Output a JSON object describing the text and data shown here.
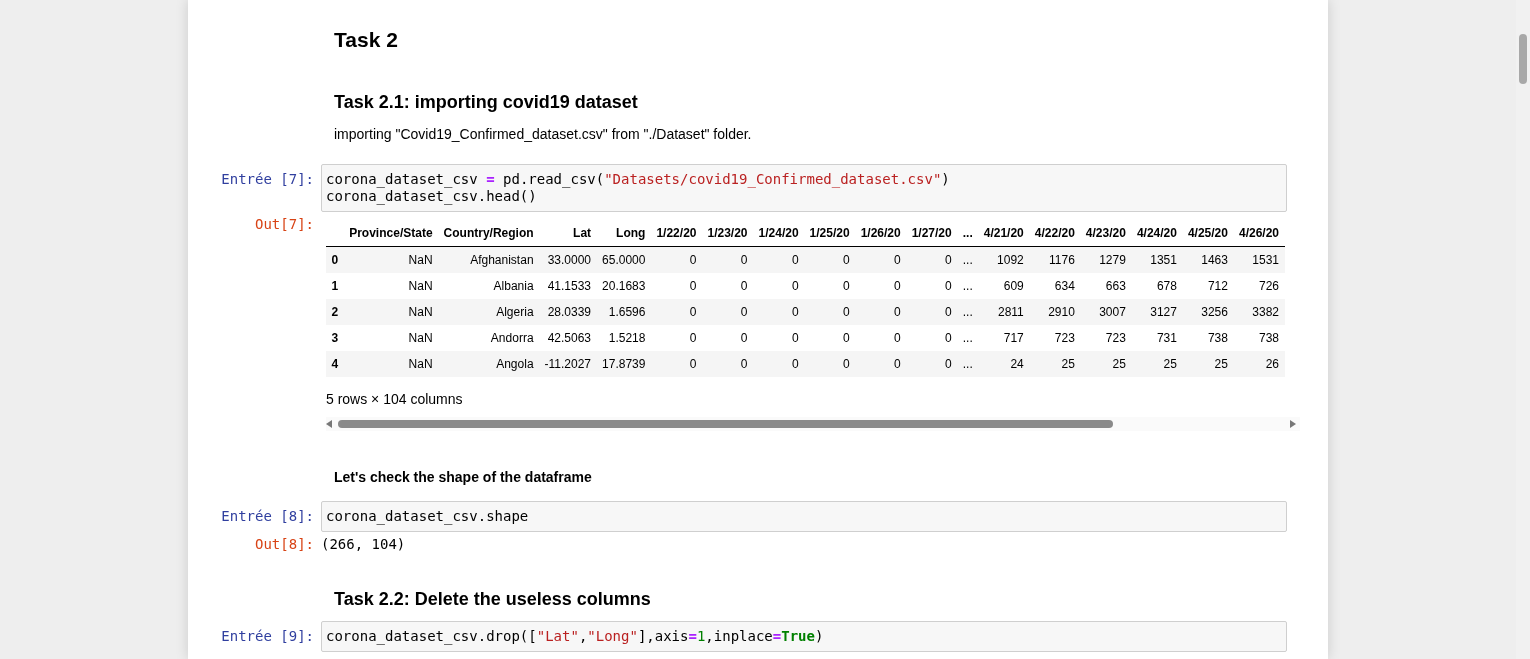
{
  "cells": [
    {
      "kind": "heading-2",
      "text": "Task 2"
    },
    {
      "kind": "heading-3",
      "text": "Task 2.1: importing covid19 dataset"
    },
    {
      "kind": "paragraph",
      "text": "importing \"Covid19_Confirmed_dataset.csv\" from \"./Dataset\" folder."
    },
    {
      "kind": "code",
      "prompt": "Entrée [7]:",
      "lines": [
        [
          {
            "text": "corona_dataset_csv ",
            "kind": "plain"
          },
          {
            "text": "=",
            "kind": "op"
          },
          {
            "text": " pd.read_csv(",
            "kind": "plain"
          },
          {
            "text": "\"Datasets/covid19_Confirmed_dataset.csv\"",
            "kind": "string"
          },
          {
            "text": ")",
            "kind": "plain"
          }
        ],
        [
          {
            "text": "corona_dataset_csv.head()",
            "kind": "plain"
          }
        ]
      ]
    },
    {
      "kind": "table",
      "prompt": "Out[7]:",
      "columns": [
        "Province/State",
        "Country/Region",
        "Lat",
        "Long",
        "1/22/20",
        "1/23/20",
        "1/24/20",
        "1/25/20",
        "1/26/20",
        "1/27/20",
        "...",
        "4/21/20",
        "4/22/20",
        "4/23/20",
        "4/24/20",
        "4/25/20",
        "4/26/20"
      ],
      "rows": [
        {
          "index": "0",
          "cells": [
            "NaN",
            "Afghanistan",
            "33.0000",
            "65.0000",
            "0",
            "0",
            "0",
            "0",
            "0",
            "0",
            "...",
            "1092",
            "1176",
            "1279",
            "1351",
            "1463",
            "1531"
          ]
        },
        {
          "index": "1",
          "cells": [
            "NaN",
            "Albania",
            "41.1533",
            "20.1683",
            "0",
            "0",
            "0",
            "0",
            "0",
            "0",
            "...",
            "609",
            "634",
            "663",
            "678",
            "712",
            "726"
          ]
        },
        {
          "index": "2",
          "cells": [
            "NaN",
            "Algeria",
            "28.0339",
            "1.6596",
            "0",
            "0",
            "0",
            "0",
            "0",
            "0",
            "...",
            "2811",
            "2910",
            "3007",
            "3127",
            "3256",
            "3382"
          ]
        },
        {
          "index": "3",
          "cells": [
            "NaN",
            "Andorra",
            "42.5063",
            "1.5218",
            "0",
            "0",
            "0",
            "0",
            "0",
            "0",
            "...",
            "717",
            "723",
            "723",
            "731",
            "738",
            "738"
          ]
        },
        {
          "index": "4",
          "cells": [
            "NaN",
            "Angola",
            "-11.2027",
            "17.8739",
            "0",
            "0",
            "0",
            "0",
            "0",
            "0",
            "...",
            "24",
            "25",
            "25",
            "25",
            "25",
            "26"
          ]
        }
      ],
      "caption": "5 rows × 104 columns"
    },
    {
      "kind": "bold-paragraph",
      "text": "Let's check the shape of the dataframe"
    },
    {
      "kind": "code",
      "prompt": "Entrée [8]:",
      "lines": [
        [
          {
            "text": "corona_dataset_csv.shape",
            "kind": "plain"
          }
        ]
      ]
    },
    {
      "kind": "output",
      "prompt": "Out[8]:",
      "text": "(266, 104)"
    },
    {
      "kind": "heading-3",
      "text": "Task 2.2: Delete the useless columns"
    },
    {
      "kind": "code",
      "prompt": "Entrée [9]:",
      "lines": [
        [
          {
            "text": "corona_dataset_csv.drop([",
            "kind": "plain"
          },
          {
            "text": "\"Lat\"",
            "kind": "string"
          },
          {
            "text": ",",
            "kind": "plain"
          },
          {
            "text": "\"Long\"",
            "kind": "string"
          },
          {
            "text": "],axis",
            "kind": "plain"
          },
          {
            "text": "=",
            "kind": "op"
          },
          {
            "text": "1",
            "kind": "number"
          },
          {
            "text": ",inplace",
            "kind": "plain"
          },
          {
            "text": "=",
            "kind": "op"
          },
          {
            "text": "True",
            "kind": "keyword"
          },
          {
            "text": ")",
            "kind": "plain"
          }
        ]
      ]
    }
  ]
}
